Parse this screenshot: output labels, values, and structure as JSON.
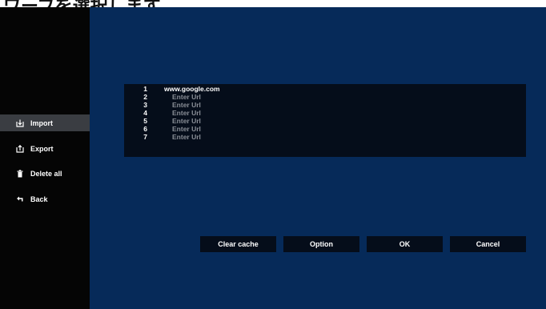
{
  "caption": "ワーブを選択します。",
  "sidebar": {
    "items": [
      {
        "label": "Import",
        "icon": "import-icon",
        "active": true
      },
      {
        "label": "Export",
        "icon": "export-icon",
        "active": false
      },
      {
        "label": "Delete all",
        "icon": "trash-icon",
        "active": false
      },
      {
        "label": "Back",
        "icon": "back-arrow-icon",
        "active": false
      }
    ]
  },
  "url_list": [
    {
      "number": "1",
      "value": "www.google.com",
      "placeholder": false
    },
    {
      "number": "2",
      "value": "Enter Url",
      "placeholder": true
    },
    {
      "number": "3",
      "value": "Enter Url",
      "placeholder": true
    },
    {
      "number": "4",
      "value": "Enter Url",
      "placeholder": true
    },
    {
      "number": "5",
      "value": "Enter Url",
      "placeholder": true
    },
    {
      "number": "6",
      "value": "Enter Url",
      "placeholder": true
    },
    {
      "number": "7",
      "value": "Enter Url",
      "placeholder": true
    }
  ],
  "buttons": {
    "clear_cache": "Clear cache",
    "option": "Option",
    "ok": "OK",
    "cancel": "Cancel"
  },
  "colors": {
    "background": "#062a59",
    "sidebar": "#050505",
    "active_item": "#3a3d42",
    "panel": "#050d1a",
    "placeholder_text": "#8a8f97"
  }
}
